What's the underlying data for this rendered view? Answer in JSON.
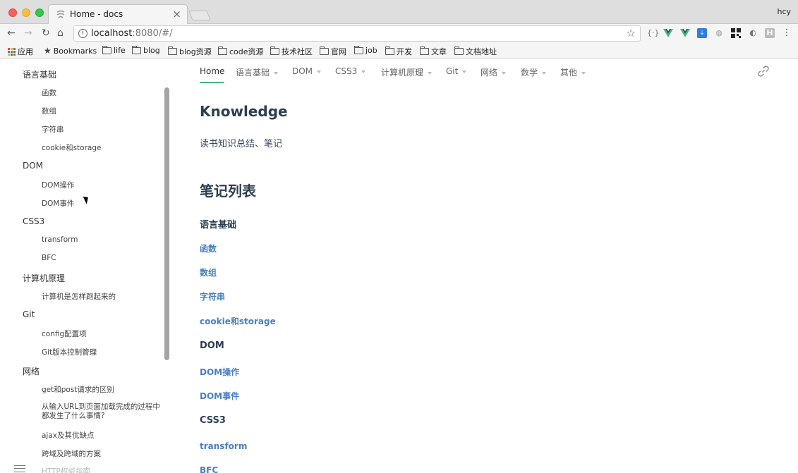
{
  "browser": {
    "tab_title": "Home - docs",
    "profile": "hcy",
    "url_host": "localhost",
    "url_rest": ":8080/#/",
    "colors": {
      "accent": "#42b983",
      "link": "#4a7fc1"
    }
  },
  "bookmarks": {
    "apps": "应用",
    "bookmarks": "Bookmarks",
    "folders": [
      "life",
      "blog",
      "blog资源",
      "code资源",
      "技术社区",
      "官网",
      "job",
      "开发",
      "文章",
      "文档地址"
    ]
  },
  "sidebar": {
    "groups": [
      {
        "label": "语言基础",
        "children": [
          "函数",
          "数组",
          "字符串",
          "cookie和storage"
        ]
      },
      {
        "label": "DOM",
        "children": [
          "DOM操作",
          "DOM事件"
        ]
      },
      {
        "label": "CSS3",
        "children": [
          "transform",
          "BFC"
        ]
      },
      {
        "label": "计算机原理",
        "children": [
          "计算机是怎样跑起来的"
        ]
      },
      {
        "label": "Git",
        "children": [
          "config配置项",
          "Git版本控制管理"
        ]
      },
      {
        "label": "网络",
        "children": [
          "get和post请求的区别",
          "从输入URL到页面加载完成的过程中都发生了什么事情?",
          "ajax及其优缺点",
          "跨域及跨域的方案",
          "HTTP权威指南"
        ]
      }
    ]
  },
  "navbar": {
    "items": [
      {
        "label": "Home",
        "active": true
      },
      {
        "label": "语言基础"
      },
      {
        "label": "DOM"
      },
      {
        "label": "CSS3"
      },
      {
        "label": "计算机原理"
      },
      {
        "label": "Git"
      },
      {
        "label": "网络"
      },
      {
        "label": "数学"
      },
      {
        "label": "其他"
      }
    ]
  },
  "content": {
    "title": "Knowledge",
    "intro": "读书知识总结、笔记",
    "list_title": "笔记列表",
    "sections": [
      {
        "heading": "语言基础",
        "links": [
          "函数",
          "数组",
          "字符串",
          "cookie和storage"
        ]
      },
      {
        "heading": "DOM",
        "links": [
          "DOM操作",
          "DOM事件"
        ]
      },
      {
        "heading": "CSS3",
        "links": [
          "transform",
          "BFC"
        ]
      }
    ]
  }
}
